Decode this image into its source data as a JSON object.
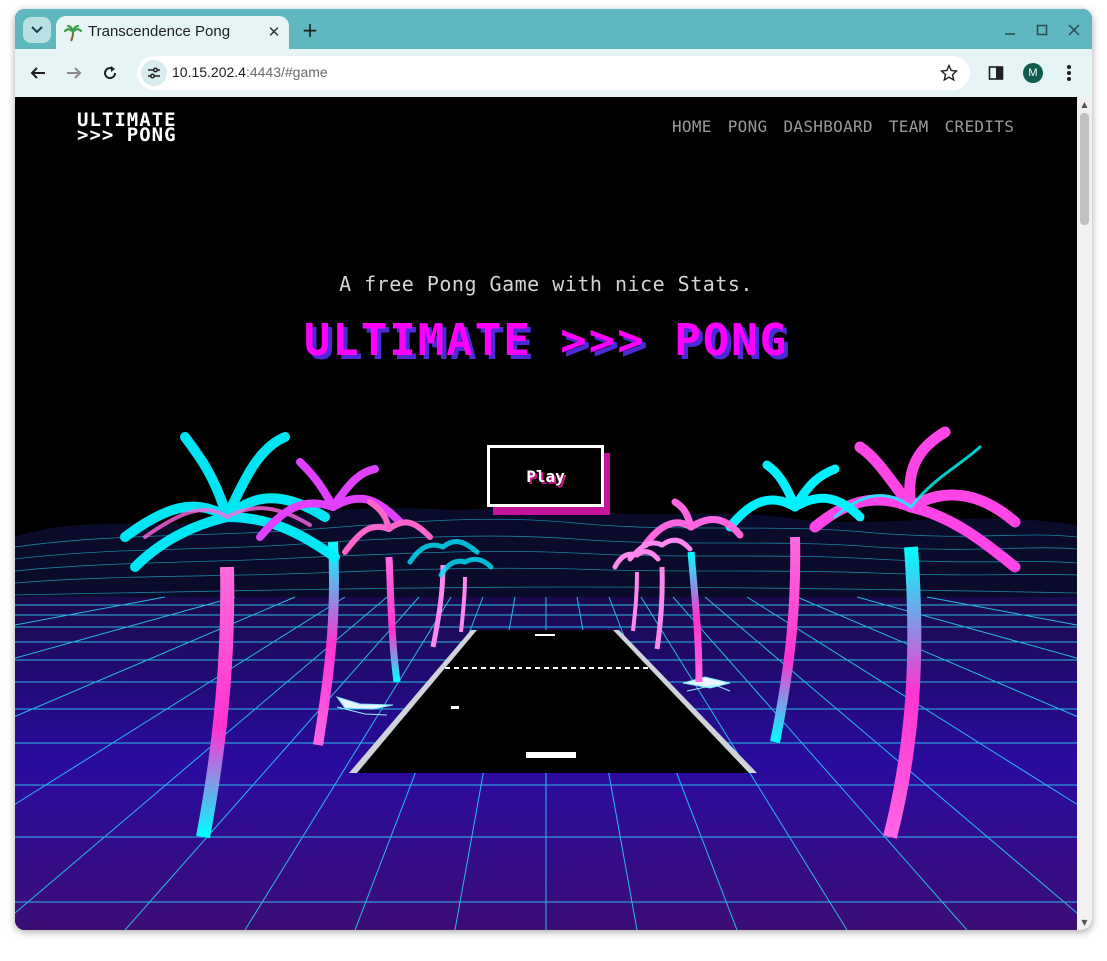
{
  "browser": {
    "tab_title": "Transcendence Pong",
    "new_tab_label": "+",
    "url_host": "10.15.202.4",
    "url_rest": ":4443/#game",
    "profile_initial": "M"
  },
  "site": {
    "logo_line1": "ULTIMATE",
    "logo_line2": ">>> PONG",
    "nav": [
      "HOME",
      "PONG",
      "DASHBOARD",
      "TEAM",
      "CREDITS"
    ],
    "tagline": "A free Pong Game with nice Stats.",
    "hero_title": "ULTIMATE >>> PONG",
    "play_label": "Play"
  },
  "colors": {
    "accent_magenta": "#ff00ff",
    "accent_cyan": "#00ffff",
    "shadow_purple": "#4b2bd6",
    "browser_frame": "#5fb8bf"
  },
  "icons": [
    "tab-search-icon",
    "palm-favicon",
    "close-icon",
    "plus-icon",
    "minimize-icon",
    "maximize-icon",
    "window-close-icon",
    "back-arrow-icon",
    "forward-arrow-icon",
    "reload-icon",
    "site-settings-icon",
    "star-icon",
    "side-panel-icon",
    "menu-dots-icon"
  ]
}
